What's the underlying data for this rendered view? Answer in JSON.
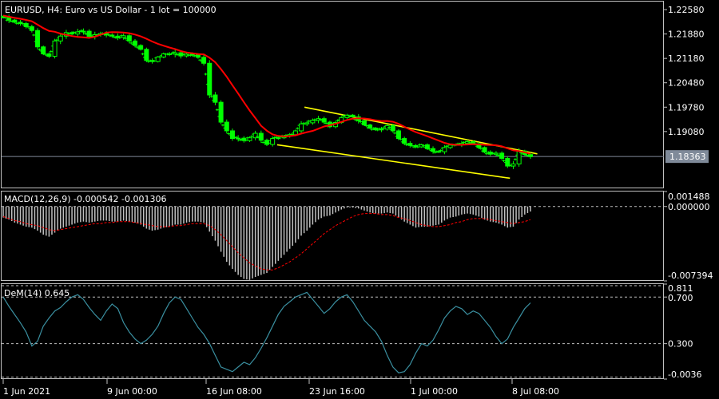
{
  "chart_data": [
    {
      "type": "candlestick",
      "title": "EURUSD, H4:  Euro vs US Dollar - 1 lot = 100000",
      "ylim": [
        1.1745,
        1.2281
      ],
      "y_ticks": [
        "1.22580",
        "1.21880",
        "1.21180",
        "1.20480",
        "1.19780",
        "1.19080"
      ],
      "current_price": "1.18363",
      "current_price_value": 1.18363,
      "moving_average": {
        "name": "",
        "color": "#ff0000"
      },
      "candle_color": "#00ff00",
      "close_series": [
        1.2235,
        1.2228,
        1.2222,
        1.2218,
        1.2209,
        1.2198,
        1.2151,
        1.2131,
        1.2124,
        1.2168,
        1.2182,
        1.2192,
        1.2188,
        1.2194,
        1.2196,
        1.2181,
        1.2186,
        1.2189,
        1.2185,
        1.2182,
        1.2178,
        1.2183,
        1.2168,
        1.2155,
        1.2144,
        1.2112,
        1.2109,
        1.2122,
        1.2131,
        1.213,
        1.2134,
        1.2125,
        1.213,
        1.2129,
        1.2121,
        1.2104,
        1.2013,
        1.1992,
        1.1935,
        1.191,
        1.1888,
        1.1889,
        1.1882,
        1.189,
        1.1903,
        1.1883,
        1.1871,
        1.1888,
        1.189,
        1.1895,
        1.1899,
        1.191,
        1.193,
        1.1933,
        1.194,
        1.1945,
        1.1935,
        1.1922,
        1.1934,
        1.1948,
        1.1955,
        1.195,
        1.1939,
        1.1927,
        1.1918,
        1.1913,
        1.1915,
        1.1925,
        1.191,
        1.1888,
        1.1874,
        1.1868,
        1.1864,
        1.187,
        1.1859,
        1.1851,
        1.185,
        1.1862,
        1.1869,
        1.1871,
        1.1874,
        1.1879,
        1.1873,
        1.1862,
        1.1849,
        1.1843,
        1.1846,
        1.1831,
        1.1809,
        1.1815,
        1.1852,
        1.1842,
        1.1836
      ],
      "yellow_channel": [
        {
          "from": [
            "23 Jun 2021",
            1.1978
          ],
          "to": [
            "10 Jul 2021",
            1.1844
          ],
          "color": "#ffff00"
        },
        {
          "from": [
            "21 Jun 2021",
            1.187
          ],
          "to": [
            "8 Jul 2021",
            1.1774
          ],
          "color": "#ffff00"
        }
      ]
    },
    {
      "type": "bar",
      "label": "MACD(12,26,9) -0.000542 -0.001306",
      "ylim": [
        -0.007394,
        0.001488
      ],
      "y_ticks": [
        "0.001488",
        "0.000000",
        "-0.007394"
      ],
      "series": [
        {
          "name": "",
          "color": "#c0c0c0",
          "values": [
            -0.0011,
            -0.0013,
            -0.0016,
            -0.0018,
            -0.002,
            -0.0021,
            -0.0024,
            -0.0028,
            -0.003,
            -0.0026,
            -0.0022,
            -0.002,
            -0.0018,
            -0.0016,
            -0.0015,
            -0.0016,
            -0.0015,
            -0.0014,
            -0.0014,
            -0.0015,
            -0.0015,
            -0.0014,
            -0.0015,
            -0.0016,
            -0.0018,
            -0.0022,
            -0.0024,
            -0.0023,
            -0.0021,
            -0.002,
            -0.0018,
            -0.0018,
            -0.0016,
            -0.0015,
            -0.0015,
            -0.0016,
            -0.0025,
            -0.0034,
            -0.0045,
            -0.0055,
            -0.0062,
            -0.0068,
            -0.0072,
            -0.0073,
            -0.007,
            -0.0068,
            -0.0066,
            -0.006,
            -0.0054,
            -0.0048,
            -0.0042,
            -0.0036,
            -0.0029,
            -0.0024,
            -0.0018,
            -0.0013,
            -0.001,
            -0.0009,
            -0.0006,
            -0.0003,
            -0.0001,
            -0.0001,
            -0.0002,
            -0.0004,
            -0.0006,
            -0.0007,
            -0.0007,
            -0.0006,
            -0.0007,
            -0.0011,
            -0.0015,
            -0.0018,
            -0.0021,
            -0.002,
            -0.002,
            -0.0019,
            -0.0018,
            -0.0014,
            -0.0011,
            -0.001,
            -0.0008,
            -0.0007,
            -0.0008,
            -0.001,
            -0.0013,
            -0.0015,
            -0.0016,
            -0.0018,
            -0.0021,
            -0.002,
            -0.0013,
            -0.0008,
            -0.0005
          ]
        },
        {
          "name": "",
          "color": "#ff0000",
          "style": "dashed",
          "values": [
            -0.001,
            -0.0012,
            -0.0014,
            -0.0015,
            -0.0017,
            -0.0018,
            -0.0019,
            -0.0021,
            -0.0023,
            -0.0024,
            -0.0023,
            -0.0022,
            -0.0021,
            -0.002,
            -0.0019,
            -0.0018,
            -0.0017,
            -0.0017,
            -0.0016,
            -0.0016,
            -0.0015,
            -0.0015,
            -0.0015,
            -0.0016,
            -0.0017,
            -0.0018,
            -0.0019,
            -0.002,
            -0.002,
            -0.002,
            -0.0019,
            -0.0019,
            -0.0018,
            -0.0017,
            -0.0017,
            -0.0017,
            -0.0019,
            -0.0023,
            -0.0028,
            -0.0034,
            -0.004,
            -0.0046,
            -0.0051,
            -0.0056,
            -0.0059,
            -0.0062,
            -0.0063,
            -0.0063,
            -0.0061,
            -0.0058,
            -0.0055,
            -0.0051,
            -0.0047,
            -0.0042,
            -0.0037,
            -0.0032,
            -0.0027,
            -0.0023,
            -0.0019,
            -0.0016,
            -0.0013,
            -0.001,
            -0.0008,
            -0.0007,
            -0.0007,
            -0.0007,
            -0.0008,
            -0.0008,
            -0.0009,
            -0.0011,
            -0.0012,
            -0.0014,
            -0.0016,
            -0.0018,
            -0.0019,
            -0.002,
            -0.002,
            -0.0019,
            -0.0018,
            -0.0016,
            -0.0015,
            -0.0013,
            -0.0012,
            -0.0012,
            -0.0012,
            -0.0013,
            -0.0014,
            -0.0015,
            -0.0016,
            -0.0017,
            -0.0016,
            -0.0015,
            -0.0013
          ]
        }
      ]
    },
    {
      "type": "line",
      "label": "DeM(14) 0.645",
      "ylim": [
        -0.0036,
        0.811
      ],
      "y_ticks": [
        "0.811",
        "0.700",
        "0.300",
        "-0.0036"
      ],
      "levels": [
        0.7,
        0.3
      ],
      "series": [
        {
          "name": "",
          "color": "#3a8fa0",
          "values": [
            0.7,
            0.62,
            0.55,
            0.48,
            0.4,
            0.28,
            0.32,
            0.45,
            0.52,
            0.58,
            0.61,
            0.66,
            0.7,
            0.72,
            0.68,
            0.61,
            0.55,
            0.5,
            0.58,
            0.64,
            0.6,
            0.48,
            0.4,
            0.34,
            0.3,
            0.33,
            0.38,
            0.45,
            0.56,
            0.65,
            0.7,
            0.68,
            0.6,
            0.52,
            0.44,
            0.38,
            0.3,
            0.2,
            0.1,
            0.08,
            0.06,
            0.1,
            0.14,
            0.12,
            0.18,
            0.26,
            0.35,
            0.45,
            0.55,
            0.62,
            0.66,
            0.7,
            0.72,
            0.74,
            0.68,
            0.62,
            0.56,
            0.6,
            0.66,
            0.7,
            0.72,
            0.66,
            0.58,
            0.5,
            0.45,
            0.4,
            0.32,
            0.2,
            0.1,
            0.05,
            0.06,
            0.12,
            0.22,
            0.3,
            0.28,
            0.33,
            0.42,
            0.52,
            0.58,
            0.62,
            0.6,
            0.55,
            0.58,
            0.56,
            0.5,
            0.44,
            0.36,
            0.3,
            0.34,
            0.44,
            0.52,
            0.6,
            0.65
          ]
        }
      ]
    }
  ],
  "x_axis": {
    "labels": [
      "1 Jun 2021",
      "9 Jun 00:00",
      "16 Jun 08:00",
      "23 Jun 16:00",
      "1 Jul 00:00",
      "8 Jul 08:00"
    ]
  }
}
